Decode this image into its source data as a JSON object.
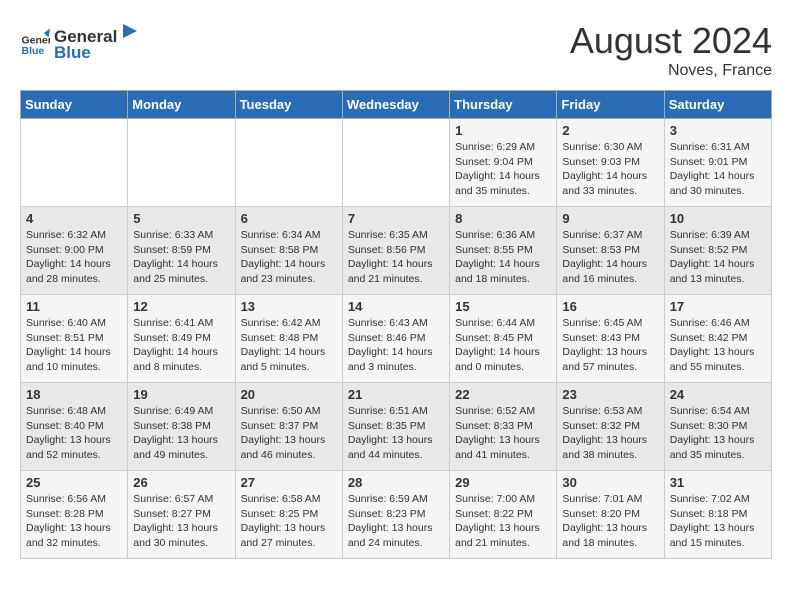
{
  "logo": {
    "text_general": "General",
    "text_blue": "Blue"
  },
  "header": {
    "month_year": "August 2024",
    "location": "Noves, France"
  },
  "weekdays": [
    "Sunday",
    "Monday",
    "Tuesday",
    "Wednesday",
    "Thursday",
    "Friday",
    "Saturday"
  ],
  "weeks": [
    [
      {
        "day": "",
        "sunrise": "",
        "sunset": "",
        "daylight": ""
      },
      {
        "day": "",
        "sunrise": "",
        "sunset": "",
        "daylight": ""
      },
      {
        "day": "",
        "sunrise": "",
        "sunset": "",
        "daylight": ""
      },
      {
        "day": "",
        "sunrise": "",
        "sunset": "",
        "daylight": ""
      },
      {
        "day": "1",
        "sunrise": "Sunrise: 6:29 AM",
        "sunset": "Sunset: 9:04 PM",
        "daylight": "Daylight: 14 hours and 35 minutes."
      },
      {
        "day": "2",
        "sunrise": "Sunrise: 6:30 AM",
        "sunset": "Sunset: 9:03 PM",
        "daylight": "Daylight: 14 hours and 33 minutes."
      },
      {
        "day": "3",
        "sunrise": "Sunrise: 6:31 AM",
        "sunset": "Sunset: 9:01 PM",
        "daylight": "Daylight: 14 hours and 30 minutes."
      }
    ],
    [
      {
        "day": "4",
        "sunrise": "Sunrise: 6:32 AM",
        "sunset": "Sunset: 9:00 PM",
        "daylight": "Daylight: 14 hours and 28 minutes."
      },
      {
        "day": "5",
        "sunrise": "Sunrise: 6:33 AM",
        "sunset": "Sunset: 8:59 PM",
        "daylight": "Daylight: 14 hours and 25 minutes."
      },
      {
        "day": "6",
        "sunrise": "Sunrise: 6:34 AM",
        "sunset": "Sunset: 8:58 PM",
        "daylight": "Daylight: 14 hours and 23 minutes."
      },
      {
        "day": "7",
        "sunrise": "Sunrise: 6:35 AM",
        "sunset": "Sunset: 8:56 PM",
        "daylight": "Daylight: 14 hours and 21 minutes."
      },
      {
        "day": "8",
        "sunrise": "Sunrise: 6:36 AM",
        "sunset": "Sunset: 8:55 PM",
        "daylight": "Daylight: 14 hours and 18 minutes."
      },
      {
        "day": "9",
        "sunrise": "Sunrise: 6:37 AM",
        "sunset": "Sunset: 8:53 PM",
        "daylight": "Daylight: 14 hours and 16 minutes."
      },
      {
        "day": "10",
        "sunrise": "Sunrise: 6:39 AM",
        "sunset": "Sunset: 8:52 PM",
        "daylight": "Daylight: 14 hours and 13 minutes."
      }
    ],
    [
      {
        "day": "11",
        "sunrise": "Sunrise: 6:40 AM",
        "sunset": "Sunset: 8:51 PM",
        "daylight": "Daylight: 14 hours and 10 minutes."
      },
      {
        "day": "12",
        "sunrise": "Sunrise: 6:41 AM",
        "sunset": "Sunset: 8:49 PM",
        "daylight": "Daylight: 14 hours and 8 minutes."
      },
      {
        "day": "13",
        "sunrise": "Sunrise: 6:42 AM",
        "sunset": "Sunset: 8:48 PM",
        "daylight": "Daylight: 14 hours and 5 minutes."
      },
      {
        "day": "14",
        "sunrise": "Sunrise: 6:43 AM",
        "sunset": "Sunset: 8:46 PM",
        "daylight": "Daylight: 14 hours and 3 minutes."
      },
      {
        "day": "15",
        "sunrise": "Sunrise: 6:44 AM",
        "sunset": "Sunset: 8:45 PM",
        "daylight": "Daylight: 14 hours and 0 minutes."
      },
      {
        "day": "16",
        "sunrise": "Sunrise: 6:45 AM",
        "sunset": "Sunset: 8:43 PM",
        "daylight": "Daylight: 13 hours and 57 minutes."
      },
      {
        "day": "17",
        "sunrise": "Sunrise: 6:46 AM",
        "sunset": "Sunset: 8:42 PM",
        "daylight": "Daylight: 13 hours and 55 minutes."
      }
    ],
    [
      {
        "day": "18",
        "sunrise": "Sunrise: 6:48 AM",
        "sunset": "Sunset: 8:40 PM",
        "daylight": "Daylight: 13 hours and 52 minutes."
      },
      {
        "day": "19",
        "sunrise": "Sunrise: 6:49 AM",
        "sunset": "Sunset: 8:38 PM",
        "daylight": "Daylight: 13 hours and 49 minutes."
      },
      {
        "day": "20",
        "sunrise": "Sunrise: 6:50 AM",
        "sunset": "Sunset: 8:37 PM",
        "daylight": "Daylight: 13 hours and 46 minutes."
      },
      {
        "day": "21",
        "sunrise": "Sunrise: 6:51 AM",
        "sunset": "Sunset: 8:35 PM",
        "daylight": "Daylight: 13 hours and 44 minutes."
      },
      {
        "day": "22",
        "sunrise": "Sunrise: 6:52 AM",
        "sunset": "Sunset: 8:33 PM",
        "daylight": "Daylight: 13 hours and 41 minutes."
      },
      {
        "day": "23",
        "sunrise": "Sunrise: 6:53 AM",
        "sunset": "Sunset: 8:32 PM",
        "daylight": "Daylight: 13 hours and 38 minutes."
      },
      {
        "day": "24",
        "sunrise": "Sunrise: 6:54 AM",
        "sunset": "Sunset: 8:30 PM",
        "daylight": "Daylight: 13 hours and 35 minutes."
      }
    ],
    [
      {
        "day": "25",
        "sunrise": "Sunrise: 6:56 AM",
        "sunset": "Sunset: 8:28 PM",
        "daylight": "Daylight: 13 hours and 32 minutes."
      },
      {
        "day": "26",
        "sunrise": "Sunrise: 6:57 AM",
        "sunset": "Sunset: 8:27 PM",
        "daylight": "Daylight: 13 hours and 30 minutes."
      },
      {
        "day": "27",
        "sunrise": "Sunrise: 6:58 AM",
        "sunset": "Sunset: 8:25 PM",
        "daylight": "Daylight: 13 hours and 27 minutes."
      },
      {
        "day": "28",
        "sunrise": "Sunrise: 6:59 AM",
        "sunset": "Sunset: 8:23 PM",
        "daylight": "Daylight: 13 hours and 24 minutes."
      },
      {
        "day": "29",
        "sunrise": "Sunrise: 7:00 AM",
        "sunset": "Sunset: 8:22 PM",
        "daylight": "Daylight: 13 hours and 21 minutes."
      },
      {
        "day": "30",
        "sunrise": "Sunrise: 7:01 AM",
        "sunset": "Sunset: 8:20 PM",
        "daylight": "Daylight: 13 hours and 18 minutes."
      },
      {
        "day": "31",
        "sunrise": "Sunrise: 7:02 AM",
        "sunset": "Sunset: 8:18 PM",
        "daylight": "Daylight: 13 hours and 15 minutes."
      }
    ]
  ]
}
